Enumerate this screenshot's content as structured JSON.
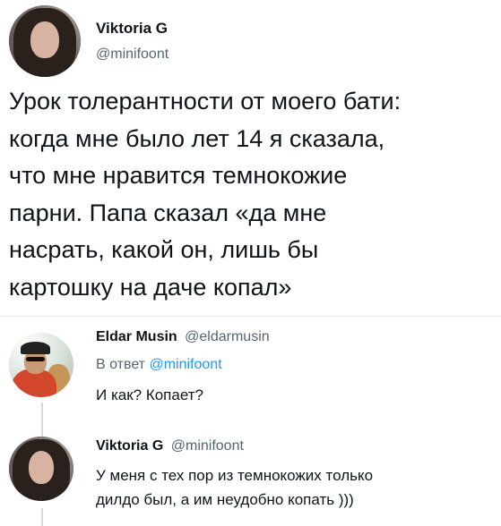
{
  "main_tweet": {
    "author_name": "Viktoria G",
    "handle": "@minifoont",
    "lines": [
      "Урок толерантности от моего бати:",
      "когда мне было лет 14 я сказала,",
      "что мне нравится темнокожие",
      "парни. Папа сказал «да мне",
      "насрать, какой он, лишь бы",
      "картошку на даче копал»"
    ]
  },
  "replies": [
    {
      "author_name": "Eldar Musin",
      "handle": "@eldarmusin",
      "reply_prefix": "В ответ",
      "reply_to": "@minifoont",
      "text": "И как? Копает?"
    },
    {
      "author_name": "Viktoria G",
      "handle": "@minifoont",
      "lines": [
        "У меня с тех пор из темнокожих только",
        "дилдо был, а им неудобно копать )))"
      ]
    }
  ],
  "colors": {
    "text": "#0f1419",
    "secondary": "#536471",
    "link": "#1d9bf0",
    "thread_line": "#cfd9de"
  }
}
